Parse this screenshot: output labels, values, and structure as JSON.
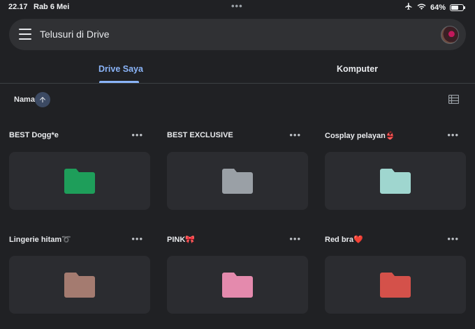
{
  "status_bar": {
    "time": "22.17",
    "date": "Rab 6 Mei",
    "battery_percent": "64%",
    "battery_level": 0.64,
    "icons": [
      "airplane-icon",
      "wifi-icon",
      "battery-icon"
    ]
  },
  "search": {
    "placeholder": "Telusuri di Drive"
  },
  "tabs": [
    {
      "label": "Drive Saya",
      "active": true
    },
    {
      "label": "Komputer",
      "active": false
    }
  ],
  "sort": {
    "label": "Nama",
    "direction": "ascending",
    "accent_color": "#8ab4f8"
  },
  "folders": [
    {
      "name": "BEST Dogg*e",
      "color": "#1e9e5a"
    },
    {
      "name": "BEST EXCLUSIVE",
      "color": "#9aa0a6"
    },
    {
      "name": "Cosplay pelayan👙",
      "color": "#9fd6cf"
    },
    {
      "name": "Lingerie hitam➰",
      "color": "#a47b70"
    },
    {
      "name": "PINK🎀",
      "color": "#e48aad"
    },
    {
      "name": "Red bra❤️",
      "color": "#d4514a"
    }
  ]
}
